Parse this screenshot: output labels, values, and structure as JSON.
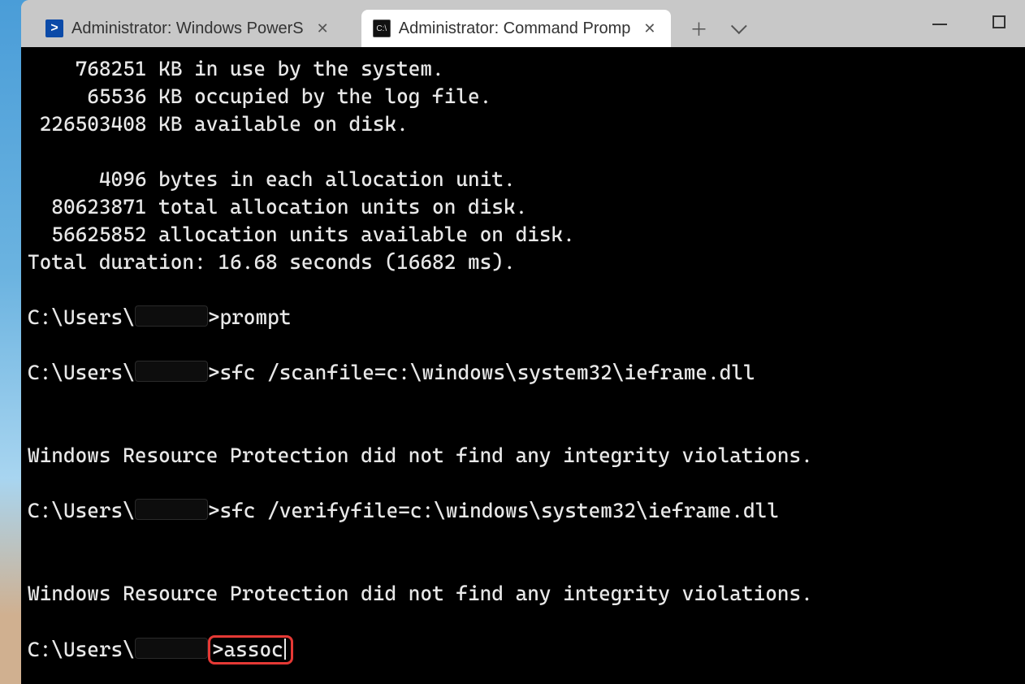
{
  "tabs": [
    {
      "title": "Administrator: Windows PowerS",
      "active": false,
      "icon": "powershell"
    },
    {
      "title": "Administrator: Command Promp",
      "active": true,
      "icon": "cmd"
    }
  ],
  "terminal": {
    "lines": [
      "    768251 KB in use by the system.",
      "     65536 KB occupied by the log file.",
      " 226503408 KB available on disk.",
      "",
      "      4096 bytes in each allocation unit.",
      "  80623871 total allocation units on disk.",
      "  56625852 allocation units available on disk.",
      "Total duration: 16.68 seconds (16682 ms)."
    ],
    "prompt_prefix": "C:\\Users\\",
    "cmd_prompt": ">prompt",
    "cmd_sfc_scan": ">sfc /scanfile=c:\\windows\\system32\\ieframe.dll",
    "wrp_msg": "Windows Resource Protection did not find any integrity violations.",
    "cmd_sfc_verify": ">sfc /verifyfile=c:\\windows\\system32\\ieframe.dll",
    "cmd_assoc_prefix": ">",
    "cmd_assoc": "assoc"
  }
}
